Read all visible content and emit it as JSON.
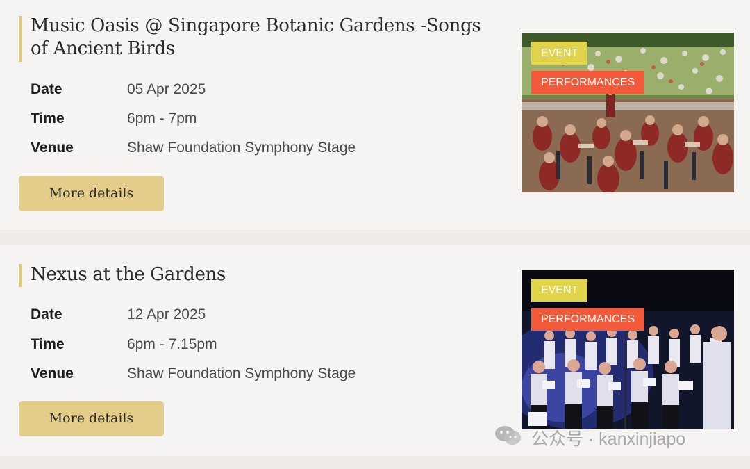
{
  "events": [
    {
      "title": "Music Oasis @ Singapore Botanic Gardens -Songs of Ancient Birds",
      "date_label": "Date",
      "date": "05 Apr 2025",
      "time_label": "Time",
      "time": "6pm - 7pm",
      "venue_label": "Venue",
      "venue": "Shaw Foundation Symphony Stage",
      "button": "More details",
      "tags": [
        "EVENT",
        "PERFORMANCES"
      ],
      "image": "outdoor-orchestra-photo"
    },
    {
      "title": "Nexus at the Gardens",
      "date_label": "Date",
      "date": "12 Apr 2025",
      "time_label": "Time",
      "time": "6pm - 7.15pm",
      "venue_label": "Venue",
      "venue": "Shaw Foundation Symphony Stage",
      "button": "More details",
      "tags": [
        "EVENT",
        "PERFORMANCES"
      ],
      "image": "choir-performance-photo"
    }
  ],
  "watermark": {
    "text": "公众号 · kanxinjiapo",
    "icon": "wechat-icon"
  },
  "colors": {
    "accent_gold": "#e3cd88",
    "tag_event": "#e2d44a",
    "tag_performances": "#f4593a"
  }
}
